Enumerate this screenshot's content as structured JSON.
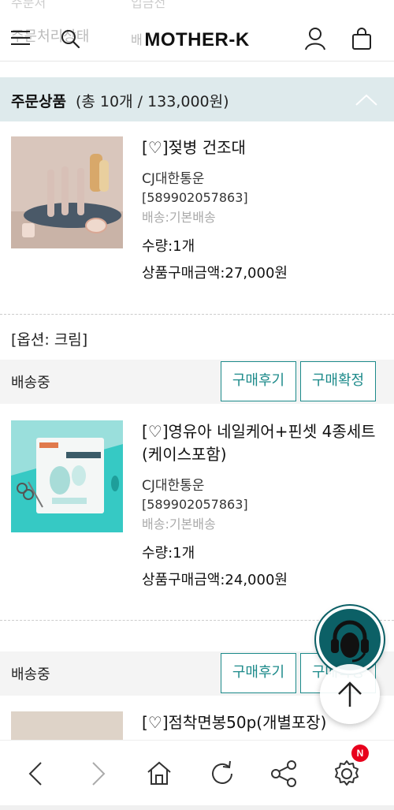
{
  "header": {
    "brand": "MOTHER-K"
  },
  "ghost": {
    "top_left": "주문처",
    "top_right": "입금전",
    "left": "주문처리상태",
    "right": "배"
  },
  "section": {
    "title": "주문상품",
    "summary": "(총 10개 / 133,000원)"
  },
  "products": [
    {
      "name": "[♡]젖병 건조대",
      "courier": "CJ대한통운",
      "tracking": "[589902057863]",
      "shipping": "배송:기본배송",
      "qty": "수량:1개",
      "amount": "상품구매금액:27,000원",
      "option": "[옵션: 크림]",
      "status": "배송중",
      "review_label": "구매후기",
      "confirm_label": "구매확정"
    },
    {
      "name": "[♡]영유아 네일케어+핀셋 4종세트 (케이스포함)",
      "courier": "CJ대한통운",
      "tracking": "[589902057863]",
      "shipping": "배송:기본배송",
      "qty": "수량:1개",
      "amount": "상품구매금액:24,000원",
      "status": "배송중",
      "review_label": "구매후기",
      "confirm_label": "구매확정"
    },
    {
      "name": "[♡]점착면봉50p(개별포장)"
    }
  ],
  "bottom_nav": {
    "items": [
      "back-icon",
      "forward-icon",
      "home-icon",
      "refresh-icon",
      "share-icon",
      "settings-icon"
    ],
    "badge": "N"
  },
  "colors": {
    "accent": "#1c8a8a",
    "section_bg": "#deeaec",
    "cs_button": "#0c6066",
    "badge": "#e8001c"
  }
}
